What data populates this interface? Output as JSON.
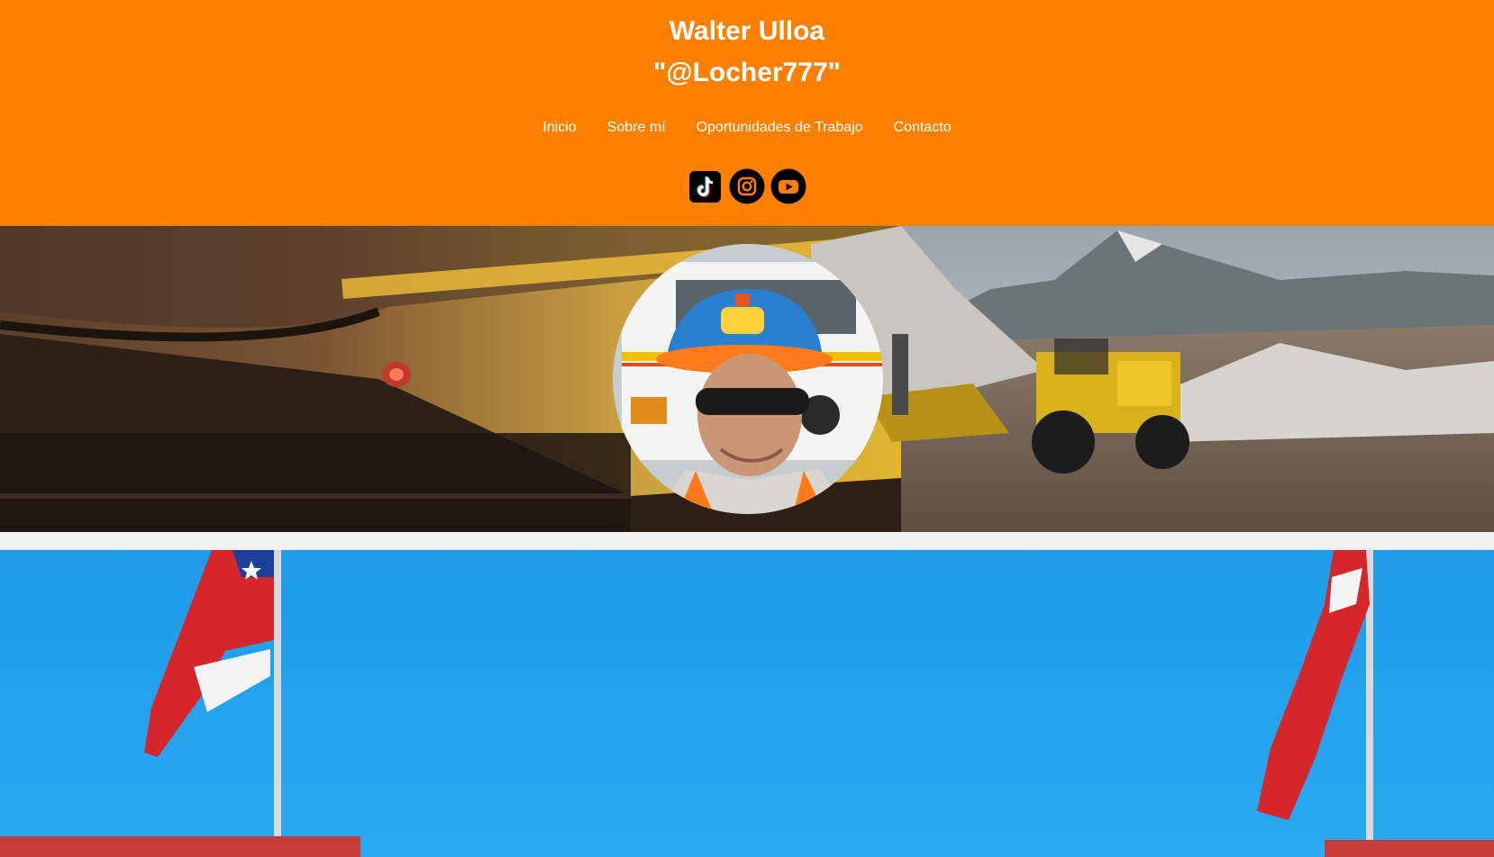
{
  "header": {
    "title_line1": "Walter Ulloa",
    "title_line2": "\"@Locher777\"",
    "background_color": "#ff8000"
  },
  "nav": {
    "items": [
      {
        "label": "Inicio"
      },
      {
        "label": "Sobre mí"
      },
      {
        "label": "Oportunidades de Trabajo"
      },
      {
        "label": "Contacto"
      }
    ]
  },
  "social": {
    "icons": [
      "tiktok-icon",
      "instagram-icon",
      "youtube-icon"
    ]
  },
  "banner": {
    "images": [
      "excavator-bucket-photo",
      "mining-loader-photo",
      "profile-avatar-photo"
    ]
  },
  "hero": {
    "image": "chilean-flags-photo"
  }
}
